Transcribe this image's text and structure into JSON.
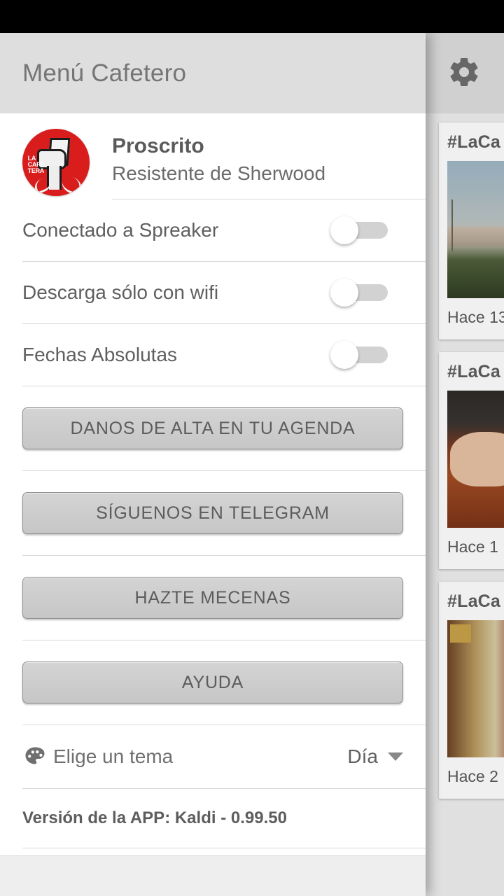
{
  "statusbar": {
    "color": "#000000"
  },
  "background": {
    "appbar": {
      "gear_icon": "gear-icon",
      "bg_color": "#dedede"
    },
    "feed": [
      {
        "title": "#LaCa",
        "time": "Hace 13",
        "thumb": "city-skyline"
      },
      {
        "title": "#LaCa",
        "time": "Hace 1",
        "thumb": "gavel-hand"
      },
      {
        "title": "#LaCa",
        "time": "Hace 2",
        "thumb": "parliament-hall"
      }
    ]
  },
  "drawer": {
    "title": "Menú Cafetero",
    "header_bg": "#dedede",
    "profile": {
      "avatar_icon": "la-cafetera-logo",
      "avatar_color": "#d91d1d",
      "avatar_brand": "LA CAFE TERA",
      "name": "Proscrito",
      "subtitle": "Resistente de Sherwood"
    },
    "toggles": [
      {
        "label": "Conectado a Spreaker",
        "value": "off"
      },
      {
        "label": "Descarga sólo con wifi",
        "value": "off"
      },
      {
        "label": "Fechas Absolutas",
        "value": "off"
      }
    ],
    "buttons": [
      {
        "label": "DANOS DE ALTA EN TU AGENDA"
      },
      {
        "label": "SÍGUENOS EN TELEGRAM"
      },
      {
        "label": "HAZTE MECENAS"
      },
      {
        "label": "AYUDA"
      }
    ],
    "theme": {
      "icon": "palette-icon",
      "label": "Elige un tema",
      "value": "Día",
      "caret": "chevron-down-icon"
    },
    "version": "Versión de la APP: Kaldi - 0.99.50"
  }
}
